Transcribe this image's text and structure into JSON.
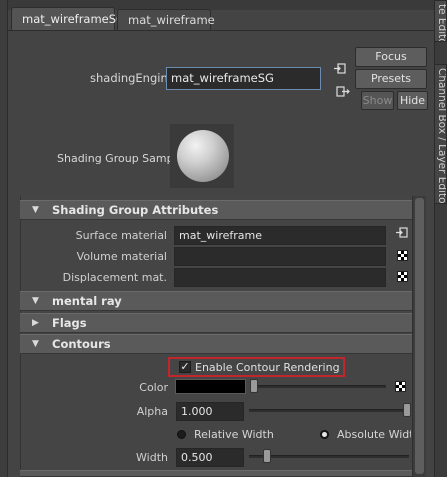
{
  "tabs": [
    {
      "label": "mat_wireframeSG",
      "active": true
    },
    {
      "label": "mat_wireframe",
      "active": false
    }
  ],
  "side_tabs": [
    "te Editor",
    "Channel Box / Layer Editor"
  ],
  "buttons": {
    "focus": "Focus",
    "presets": "Presets",
    "show": "Show",
    "hide": "Hide"
  },
  "shading_engine": {
    "label": "shadingEngine:",
    "value": "mat_wireframeSG"
  },
  "swatch": {
    "label": "Shading Group Sample"
  },
  "sections": {
    "shading_group_attributes": {
      "title": "Shading Group Attributes",
      "expanded": true,
      "rows": [
        {
          "label": "Surface material",
          "value": "mat_wireframe"
        },
        {
          "label": "Volume material",
          "value": ""
        },
        {
          "label": "Displacement mat.",
          "value": ""
        }
      ]
    },
    "mental_ray": {
      "title": "mental ray",
      "expanded": true
    },
    "flags": {
      "title": "Flags",
      "expanded": false
    },
    "contours": {
      "title": "Contours",
      "expanded": true,
      "enable_label": "Enable Contour Rendering",
      "enable_checked": true,
      "color_label": "Color",
      "color_value": "#000000",
      "alpha_label": "Alpha",
      "alpha_value": "1.000",
      "relative_width_label": "Relative Width",
      "absolute_width_label": "Absolute Width",
      "width_mode": "absolute",
      "width_label": "Width",
      "width_value": "0.500"
    }
  },
  "colors": {
    "highlight_box": "#c0262c",
    "field_focus_border": "#6c8bb0"
  }
}
